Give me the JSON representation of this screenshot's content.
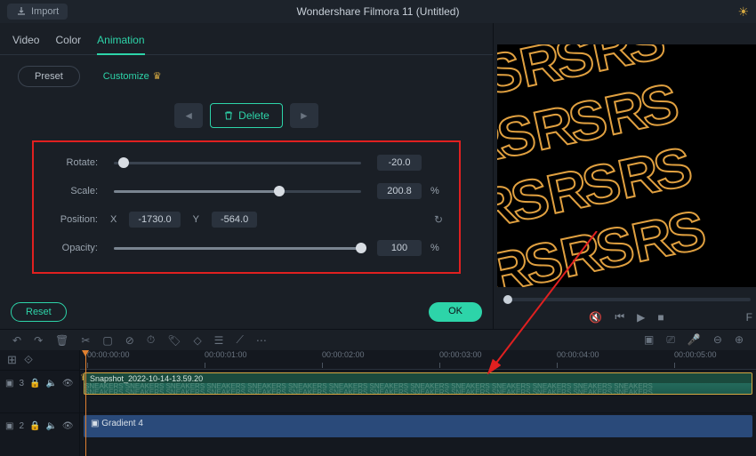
{
  "header": {
    "import": "Import",
    "title": "Wondershare Filmora 11 (Untitled)"
  },
  "tabs": [
    "Video",
    "Color",
    "Animation"
  ],
  "activeTab": 2,
  "subTabs": {
    "preset": "Preset",
    "customize": "Customize"
  },
  "actions": {
    "delete": "Delete",
    "reset": "Reset",
    "ok": "OK"
  },
  "props": {
    "rotate": {
      "label": "Rotate:",
      "value": "-20.0",
      "pct": 4
    },
    "scale": {
      "label": "Scale:",
      "value": "200.8",
      "unit": "%",
      "pct": 67
    },
    "position": {
      "label": "Position:",
      "x_label": "X",
      "x_value": "-1730.0",
      "y_label": "Y",
      "y_value": "-564.0"
    },
    "opacity": {
      "label": "Opacity:",
      "value": "100",
      "unit": "%",
      "pct": 100
    }
  },
  "ruler": [
    "00:00:00:00",
    "00:00:01:00",
    "00:00:02:00",
    "00:00:03:00",
    "00:00:04:00",
    "00:00:05:00"
  ],
  "tracks": {
    "t1": {
      "label": "3",
      "clip": "Snapshot_2022-10-14-13.59.20"
    },
    "t2": {
      "label": "2",
      "clip": "Gradient 4"
    }
  }
}
